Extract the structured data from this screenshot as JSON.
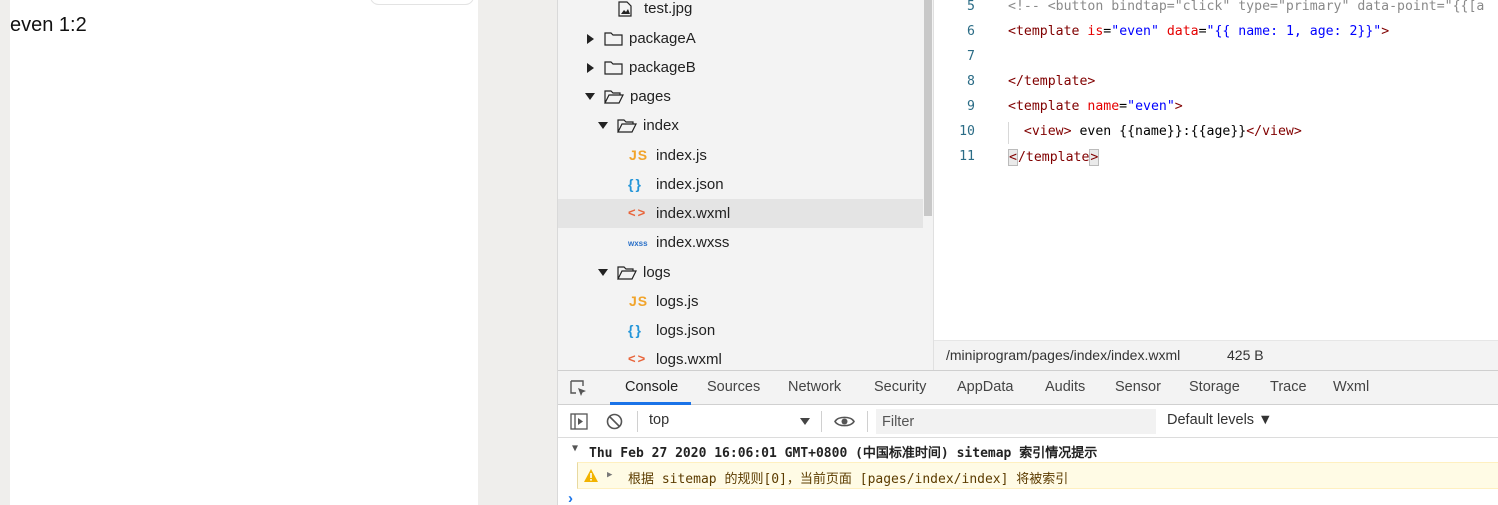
{
  "simulator": {
    "output_text": "even 1:2"
  },
  "file_tree": {
    "items": [
      {
        "label": "test.jpg",
        "icon": "image-file-icon"
      },
      {
        "label": "packageA",
        "icon": "folder-closed-icon"
      },
      {
        "label": "packageB",
        "icon": "folder-closed-icon"
      },
      {
        "label": "pages",
        "icon": "folder-open-icon"
      },
      {
        "label": "index",
        "icon": "folder-open-icon"
      },
      {
        "label": "index.js",
        "icon": "js-file-icon",
        "glyph": "JS"
      },
      {
        "label": "index.json",
        "icon": "json-file-icon",
        "glyph": "{}"
      },
      {
        "label": "index.wxml",
        "icon": "wxml-file-icon",
        "glyph": "<>"
      },
      {
        "label": "index.wxss",
        "icon": "wxss-file-icon",
        "glyph": "wxss"
      },
      {
        "label": "logs",
        "icon": "folder-open-icon"
      },
      {
        "label": "logs.js",
        "icon": "js-file-icon",
        "glyph": "JS"
      },
      {
        "label": "logs.json",
        "icon": "json-file-icon",
        "glyph": "{}"
      },
      {
        "label": "logs.wxml",
        "icon": "wxml-file-icon",
        "glyph": "<>"
      }
    ]
  },
  "editor": {
    "lines": [
      {
        "num": "5"
      },
      {
        "num": "6"
      },
      {
        "num": "7"
      },
      {
        "num": "8"
      },
      {
        "num": "9"
      },
      {
        "num": "10"
      },
      {
        "num": "11"
      }
    ],
    "tokens": {
      "l5_comment": "<!-- <button bindtap=\"click\" type=\"primary\" data-point=\"{{[a",
      "l6_open": "<template",
      "l6_attr1": " is",
      "l6_eq1": "=",
      "l6_val1": "\"even\"",
      "l6_attr2": " data",
      "l6_eq2": "=",
      "l6_val2": "\"{{ name: 1, age: 2}}\"",
      "l6_close": ">",
      "l8_tag": "</template>",
      "l9_open": "<template",
      "l9_attr": " name",
      "l9_eq": "=",
      "l9_val": "\"even\"",
      "l9_close": ">",
      "l10_indent": "  ",
      "l10_open": "<view>",
      "l10_text": " even {{name}}:{{age}}",
      "l10_close": "</view>",
      "l11_lt": "<",
      "l11_tag": "/template",
      "l11_gt": ">"
    }
  },
  "editor_status": {
    "path": "/miniprogram/pages/index/index.wxml",
    "size": "425 B"
  },
  "devtools": {
    "tabs": [
      {
        "label": "Console",
        "active": true
      },
      {
        "label": "Sources"
      },
      {
        "label": "Network"
      },
      {
        "label": "Security"
      },
      {
        "label": "AppData"
      },
      {
        "label": "Audits"
      },
      {
        "label": "Sensor"
      },
      {
        "label": "Storage"
      },
      {
        "label": "Trace"
      },
      {
        "label": "Wxml"
      }
    ],
    "toolbar": {
      "context": "top",
      "filter_placeholder": "Filter",
      "levels": "Default levels ▼"
    },
    "console": {
      "group_header": "Thu Feb 27 2020 16:06:01 GMT+0800 (中国标准时间) sitemap 索引情况提示",
      "warning": "根据 sitemap 的规则[0]，当前页面 [pages/index/index] 将被索引",
      "prompt": "›"
    }
  },
  "colors": {
    "accent": "#1a73e8",
    "js_icon": "#f1a42b",
    "json_icon": "#2596d9",
    "wxml_icon": "#e8643a",
    "wxss_icon": "#2a70c8",
    "warning_bg": "#fffbe5"
  }
}
